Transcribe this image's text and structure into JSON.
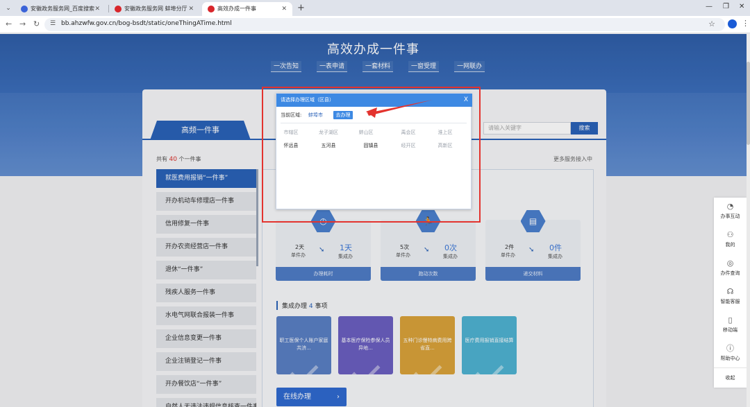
{
  "browser": {
    "tabs": [
      {
        "title": "安徽政务服务网_百度搜索",
        "active": false
      },
      {
        "title": "安徽政务服务网 蚌埠分厅",
        "active": false
      },
      {
        "title": "高效办成一件事",
        "active": true
      }
    ],
    "url": "bb.ahzwfw.gov.cn/bog-bsdt/static/oneThingATime.html"
  },
  "hero": {
    "title": "高效办成一件事",
    "tags": [
      "一次告知",
      "一表申请",
      "一套材料",
      "一窗受理",
      "一网联办"
    ]
  },
  "main_tab": "高频一件事",
  "search": {
    "placeholder": "请输入关键字",
    "button": "搜索"
  },
  "count": {
    "prefix": "共有",
    "num": "40",
    "suffix": "个一件事"
  },
  "more_link": "更多服务接入中",
  "list_items": [
    "就医费用报销“一件事”",
    "开办机动车修理店一件事",
    "信用修复一件事",
    "开办农资经营店一件事",
    "退休“一件事”",
    "残疾人服务一件事",
    "水电气网联合报装一件事",
    "企业信息变更一件事",
    "企业注销登记一件事",
    "开办餐饮店“一件事”",
    "自然人无违法违规信息核查一件事"
  ],
  "stats": [
    {
      "icon": "clock-icon",
      "left_value": "2天",
      "left_label": "单件办",
      "right_value": "1天",
      "right_label": "集成办",
      "footer": "办理耗时"
    },
    {
      "icon": "runner-icon",
      "left_value": "5次",
      "left_label": "单件办",
      "right_value": "0次",
      "right_label": "集成办",
      "footer": "跑动次数"
    },
    {
      "icon": "document-icon",
      "left_value": "2件",
      "left_label": "单件办",
      "right_value": "0件",
      "right_label": "集成办",
      "footer": "递交材料"
    }
  ],
  "integrated": {
    "prefix": "集成办理",
    "num": "4",
    "suffix": "事项"
  },
  "tiles": [
    {
      "text": "职工医保个人账户家庭共济...",
      "color": "#5a7fc4"
    },
    {
      "text": "基本医疗保险参保人员异地...",
      "color": "#6b5fc0"
    },
    {
      "text": "五种门诊慢特病费用跨省直...",
      "color": "#d9a23a"
    },
    {
      "text": "医疗费用报销直接结算",
      "color": "#4fb2d2"
    }
  ],
  "online_button": "在线办理",
  "modal": {
    "title": "请选择办理区域（区县）",
    "close": "X",
    "current_label": "当前区域:",
    "current_city": "蚌埠市",
    "go_button": "去办理",
    "regions_row1": [
      "市辖区",
      "龙子湖区",
      "蚌山区",
      "禹会区",
      "淮上区"
    ],
    "regions_row2_active": [
      "怀远县",
      "五河县",
      "固镇县"
    ],
    "regions_row2_dim": [
      "经开区",
      "高新区"
    ]
  },
  "side_menu": [
    {
      "label": "办事互动",
      "icon": "chat-icon"
    },
    {
      "label": "我的",
      "icon": "user-icon"
    },
    {
      "label": "办件查询",
      "icon": "search-icon"
    },
    {
      "label": "智能客服",
      "icon": "headset-icon"
    },
    {
      "label": "移动端",
      "icon": "mobile-icon"
    },
    {
      "label": "帮助中心",
      "icon": "help-icon"
    }
  ],
  "side_collapse": "收起"
}
